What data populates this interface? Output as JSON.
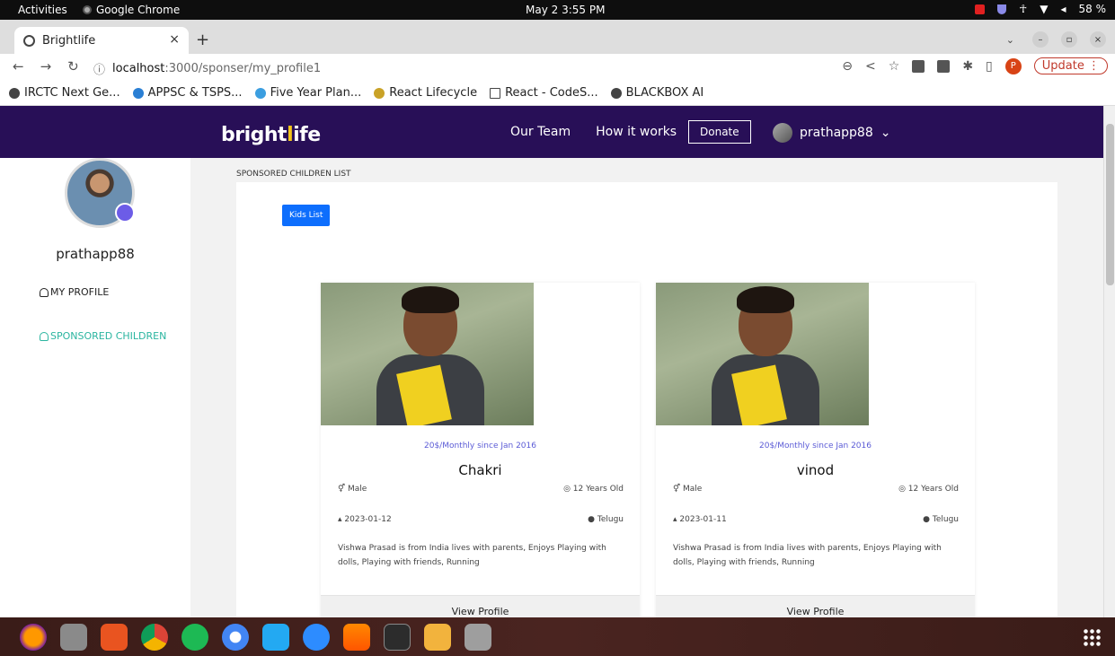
{
  "system_bar": {
    "activities": "Activities",
    "app_name": "Google Chrome",
    "clock": "May 2  3:55 PM",
    "battery": "58 %"
  },
  "browser": {
    "tab_title": "Brightlife",
    "url_host": "localhost",
    "url_rest": ":3000/sponser/my_profile1",
    "update_label": "Update",
    "profile_initial": "P",
    "bookmarks": [
      "IRCTC Next Ge...",
      "APPSC & TSPS...",
      "Five Year Plan...",
      "React Lifecycle",
      "React - CodeS...",
      "BLACKBOX AI"
    ]
  },
  "header": {
    "logo_left": "bright",
    "logo_i": "l",
    "logo_right": "ife",
    "menu": [
      "Our Team",
      "How it works"
    ],
    "donate": "Donate",
    "username": "prathapp88",
    "dropdown": "⌄"
  },
  "sidebar": {
    "username": "prathapp88",
    "links": [
      "MY PROFILE",
      "SPONSORED CHILDREN"
    ],
    "active_color": "#2bb5a0"
  },
  "main": {
    "title": "SPONSORED CHILDREN LIST",
    "kids_button": "Kids List",
    "cards": [
      {
        "price": "20$/Monthly since Jan 2016",
        "name": "Chakri",
        "gender": "Male",
        "age": "12 Years Old",
        "dob": "2023-01-12",
        "language": "Telugu",
        "description": "Vishwa Prasad is from India lives with parents, Enjoys Playing with dolls, Playing with friends, Running",
        "view": "View Profile"
      },
      {
        "price": "20$/Monthly since Jan 2016",
        "name": "vinod",
        "gender": "Male",
        "age": "12 Years Old",
        "dob": "2023-01-11",
        "language": "Telugu",
        "description": "Vishwa Prasad is from India lives with parents, Enjoys Playing with dolls, Playing with friends, Running",
        "view": "View Profile"
      }
    ]
  },
  "dock_apps": [
    "firefox-icon",
    "files-icon",
    "software-icon",
    "chrome-icon",
    "spotify-icon",
    "chromium-icon",
    "vscode-icon",
    "zoom-icon",
    "vlc-icon",
    "terminal-icon",
    "image-viewer-icon",
    "trash-icon"
  ]
}
